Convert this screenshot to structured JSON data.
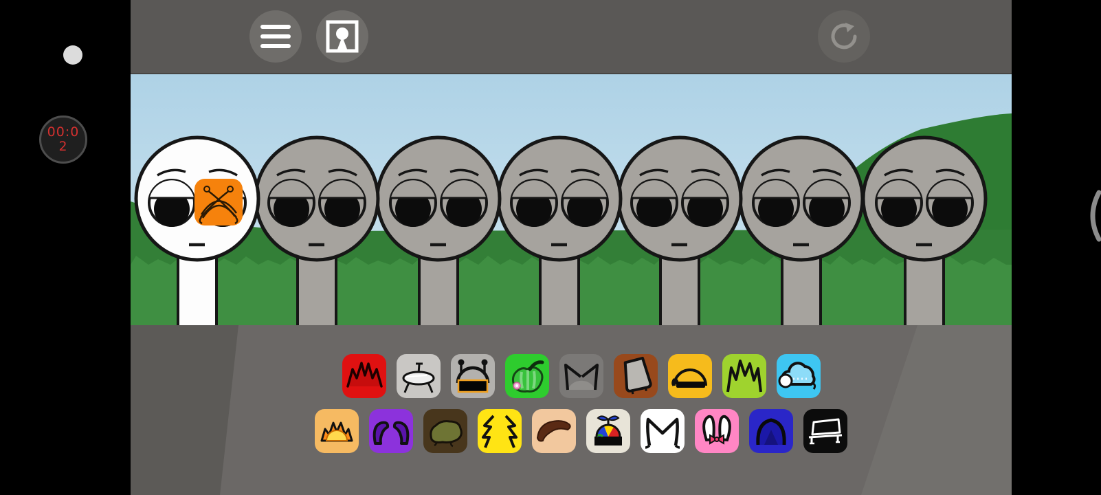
{
  "hud": {
    "timer": {
      "line1": "00:0",
      "line2": "2"
    },
    "timer_color": "#d3302f",
    "record_dot_color": "#dcdcdc"
  },
  "topbar": {
    "icons": [
      {
        "name": "hamburger-menu-icon",
        "action": "open-menu"
      },
      {
        "name": "portrait-frame-icon",
        "action": "character-select"
      },
      {
        "name": "reset-icon",
        "action": "restart"
      }
    ],
    "bar_color": "#5a5856"
  },
  "scene": {
    "colors": {
      "sky_top": "#aed2e6",
      "sky_bottom": "#cfe5f0",
      "hill": "#2e7c33",
      "back_grass": "#337f37",
      "front_grass": "#3f8f42",
      "outline": "#161616"
    },
    "characters": [
      {
        "id": 1,
        "color": "#fdfdfd",
        "kind": "white-polo",
        "wearing": "orange-drum-badge"
      },
      {
        "id": 2,
        "color": "#a6a39e",
        "kind": "gray-polo",
        "wearing": "none"
      },
      {
        "id": 3,
        "color": "#a6a39e",
        "kind": "gray-polo",
        "wearing": "none"
      },
      {
        "id": 4,
        "color": "#a6a39e",
        "kind": "gray-polo",
        "wearing": "none"
      },
      {
        "id": 5,
        "color": "#a6a39e",
        "kind": "gray-polo",
        "wearing": "none"
      },
      {
        "id": 6,
        "color": "#a6a39e",
        "kind": "gray-polo",
        "wearing": "none"
      },
      {
        "id": 7,
        "color": "#a6a39e",
        "kind": "gray-polo",
        "wearing": "none"
      }
    ],
    "badge_color": "#f6820c"
  },
  "stage": {
    "floor_color": "#6b6866",
    "row1": [
      {
        "name": "red-spiky-crown",
        "color": "#e01111"
      },
      {
        "name": "silver-saucer-hat",
        "color": "#c9c7c4"
      },
      {
        "name": "antenna-visor",
        "color": "#b3b1ae"
      },
      {
        "name": "green-pepper-hat",
        "color": "#2ecc2e"
      },
      {
        "name": "gray-cat-ears-dimmed",
        "color": "#7b7977"
      },
      {
        "name": "brown-tilted-cap",
        "color": "#98491c"
      },
      {
        "name": "amber-sleeper",
        "color": "#f6bb1c"
      },
      {
        "name": "lime-spiky-grass",
        "color": "#9fd32e"
      },
      {
        "name": "cyan-rain-cloud",
        "color": "#3ec6f2"
      }
    ],
    "row2": [
      {
        "name": "sun-crown",
        "color": "#f6ba62"
      },
      {
        "name": "purple-horns",
        "color": "#8c32dc"
      },
      {
        "name": "moss-wig",
        "color": "#48361c"
      },
      {
        "name": "lightning-horns",
        "color": "#ffe414"
      },
      {
        "name": "brown-side-hair",
        "color": "#f2c89e"
      },
      {
        "name": "propeller-cap",
        "color": "#e8e4d8"
      },
      {
        "name": "white-cat-ears",
        "color": "#ffffff"
      },
      {
        "name": "bunny-ears",
        "color": "#ff86c4"
      },
      {
        "name": "navy-hood",
        "color": "#2a26c8"
      },
      {
        "name": "black-bench",
        "color": "#0c0c0c"
      }
    ]
  }
}
